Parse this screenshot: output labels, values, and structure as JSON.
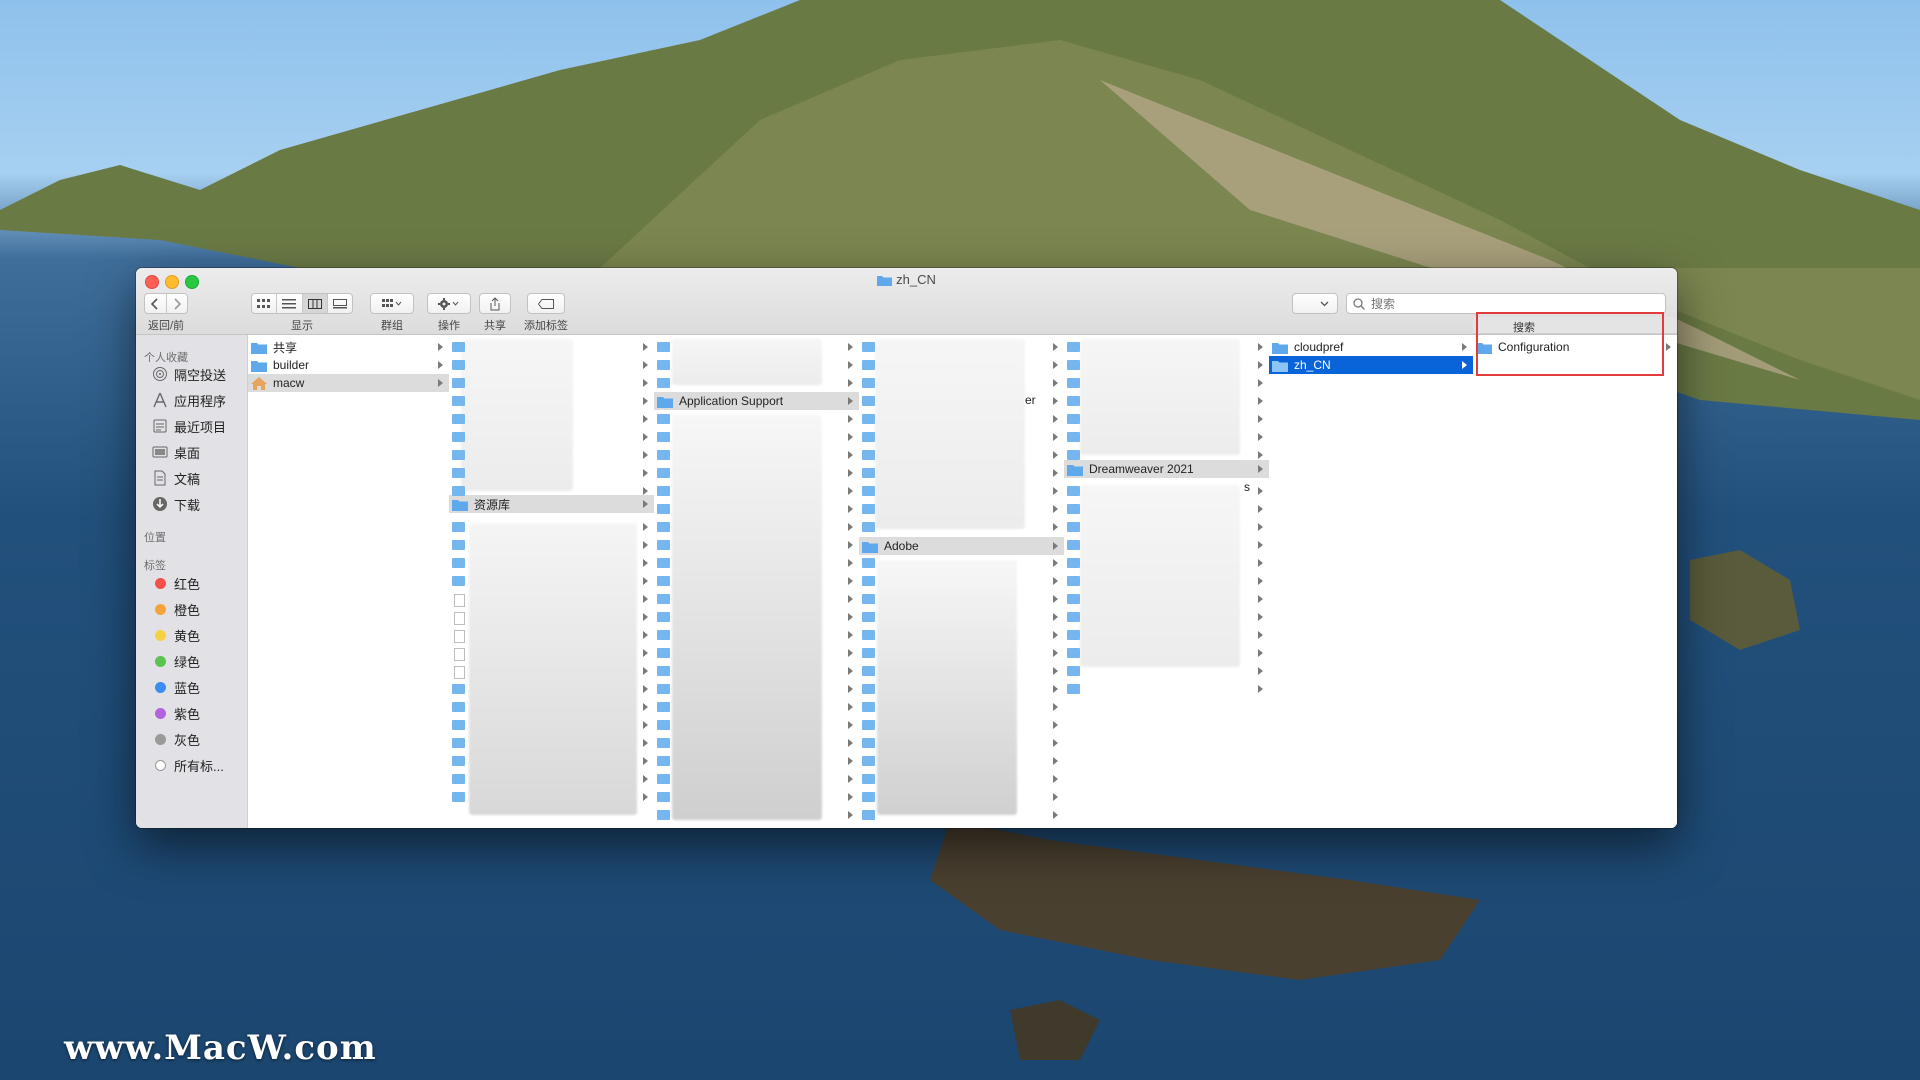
{
  "window": {
    "title": "zh_CN"
  },
  "toolbar": {
    "nav_label": "返回/前进",
    "view_label": "显示",
    "group_label": "群组",
    "action_label": "操作",
    "share_label": "共享",
    "tags_label": "添加标签",
    "search_placeholder": "搜索"
  },
  "sidebar": {
    "favorites_header": "个人收藏",
    "favorites": [
      {
        "label": "隔空投送",
        "icon": "airdrop-icon"
      },
      {
        "label": "应用程序",
        "icon": "applications-icon"
      },
      {
        "label": "最近项目",
        "icon": "recents-icon"
      },
      {
        "label": "桌面",
        "icon": "desktop-icon"
      },
      {
        "label": "文稿",
        "icon": "documents-icon"
      },
      {
        "label": "下载",
        "icon": "downloads-icon"
      }
    ],
    "locations_header": "位置",
    "tags_header": "标签",
    "tags": [
      {
        "label": "红色",
        "color": "#f5514a"
      },
      {
        "label": "橙色",
        "color": "#f6a33a"
      },
      {
        "label": "黄色",
        "color": "#f7d144"
      },
      {
        "label": "绿色",
        "color": "#5ac451"
      },
      {
        "label": "蓝色",
        "color": "#3b8cf3"
      },
      {
        "label": "紫色",
        "color": "#b264de"
      },
      {
        "label": "灰色",
        "color": "#9a9a9a"
      },
      {
        "label": "所有标...",
        "color": "#c8c8c8"
      }
    ]
  },
  "columns": {
    "col1": [
      "共享",
      "builder",
      "macw"
    ],
    "col2_selected": "资源库",
    "col3_selected": "Application Support",
    "col4_selected": "Adobe",
    "col4_partial": "er",
    "col5_selected": "Dreamweaver 2021",
    "col5_partial": "s",
    "col6": [
      "cloudpref",
      "zh_CN"
    ],
    "col7_scope": "搜索",
    "col7": [
      "Configuration"
    ]
  },
  "watermark": "www.MacW.com"
}
